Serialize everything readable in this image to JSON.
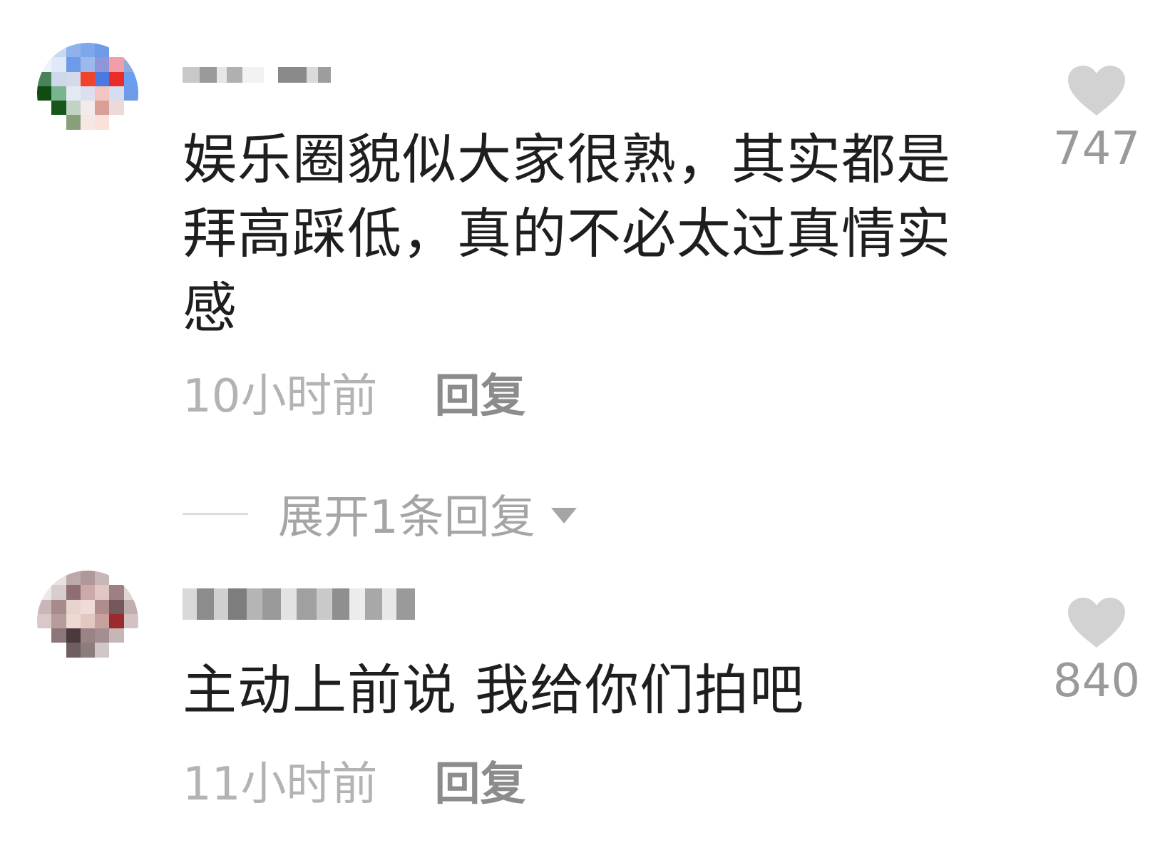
{
  "comments": [
    {
      "text": "娱乐圈貌似大家很熟，其实都是拜高踩低，真的不必太过真情实感",
      "time": "10小时前",
      "reply_label": "回复",
      "likes": "747",
      "expand_label": "展开1条回复"
    },
    {
      "text": "主动上前说 我给你们拍吧",
      "time": "11小时前",
      "reply_label": "回复",
      "likes": "840"
    }
  ],
  "icons": {
    "like": "heart-icon",
    "expand": "caret-down-icon"
  },
  "colors": {
    "heart": "#d2d2d2",
    "time_text": "#b3b3b3",
    "reply_text": "#8c8c8c"
  }
}
